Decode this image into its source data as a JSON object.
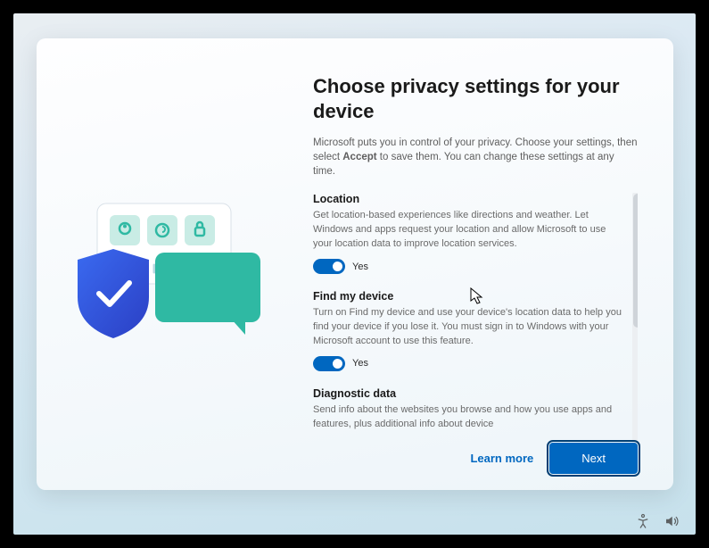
{
  "title": "Choose privacy settings for your device",
  "intro_pre": "Microsoft puts you in control of your privacy. Choose your settings, then select ",
  "intro_bold": "Accept",
  "intro_post": " to save them. You can change these settings at any time.",
  "sections": {
    "location": {
      "title": "Location",
      "body": "Get location-based experiences like directions and weather. Let Windows and apps request your location and allow Microsoft to use your location data to improve location services.",
      "toggle_label": "Yes"
    },
    "find": {
      "title": "Find my device",
      "body": "Turn on Find my device and use your device's location data to help you find your device if you lose it. You must sign in to Windows with your Microsoft account to use this feature.",
      "toggle_label": "Yes"
    },
    "diag": {
      "title": "Diagnostic data",
      "body": "Send info about the websites you browse and how you use apps and features, plus additional info about device"
    }
  },
  "actions": {
    "learn_more": "Learn more",
    "next": "Next"
  }
}
